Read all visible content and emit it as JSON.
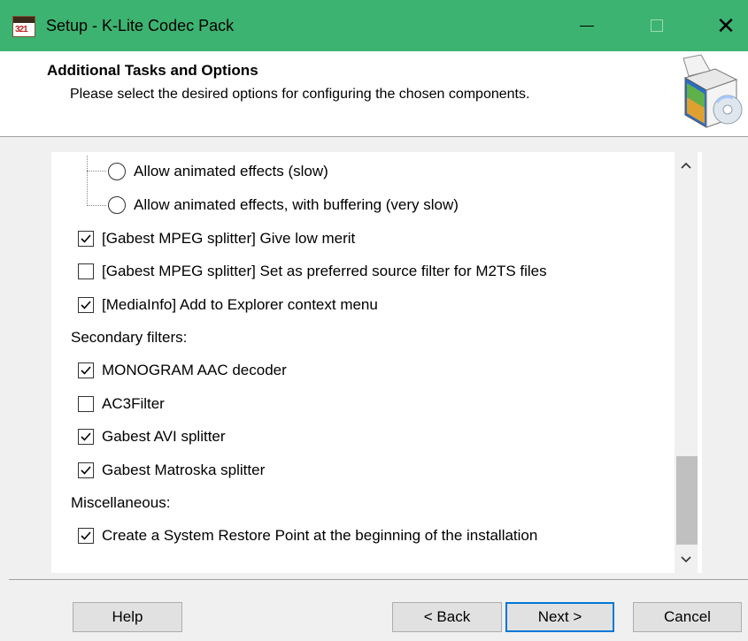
{
  "window": {
    "title": "Setup - K-Lite Codec Pack",
    "icon_text": "321",
    "close_glyph": "✕"
  },
  "header": {
    "title": "Additional Tasks and Options",
    "subtitle": "Please select the desired options for configuring the chosen components."
  },
  "options": [
    {
      "kind": "radio",
      "label": "Allow animated effects (slow)",
      "checked": false
    },
    {
      "kind": "radio",
      "label": "Allow animated effects, with buffering (very slow)",
      "checked": false
    },
    {
      "kind": "checkbox",
      "label": "[Gabest MPEG splitter] Give low merit",
      "checked": true
    },
    {
      "kind": "checkbox",
      "label": "[Gabest MPEG splitter] Set as preferred source filter for M2TS files",
      "checked": false
    },
    {
      "kind": "checkbox",
      "label": "[MediaInfo] Add to Explorer context menu",
      "checked": true
    },
    {
      "kind": "heading",
      "label": "Secondary filters:"
    },
    {
      "kind": "checkbox",
      "label": "MONOGRAM AAC decoder",
      "checked": true
    },
    {
      "kind": "checkbox",
      "label": "AC3Filter",
      "checked": false
    },
    {
      "kind": "checkbox",
      "label": "Gabest AVI splitter",
      "checked": true
    },
    {
      "kind": "checkbox",
      "label": "Gabest Matroska splitter",
      "checked": true
    },
    {
      "kind": "heading",
      "label": "Miscellaneous:"
    },
    {
      "kind": "checkbox",
      "label": "Create a System Restore Point at the beginning of the installation",
      "checked": true
    }
  ],
  "buttons": {
    "help": "Help",
    "back": "< Back",
    "next": "Next >",
    "cancel": "Cancel"
  },
  "colors": {
    "titlebar": "#3cb371",
    "default_button_border": "#0078d7"
  }
}
